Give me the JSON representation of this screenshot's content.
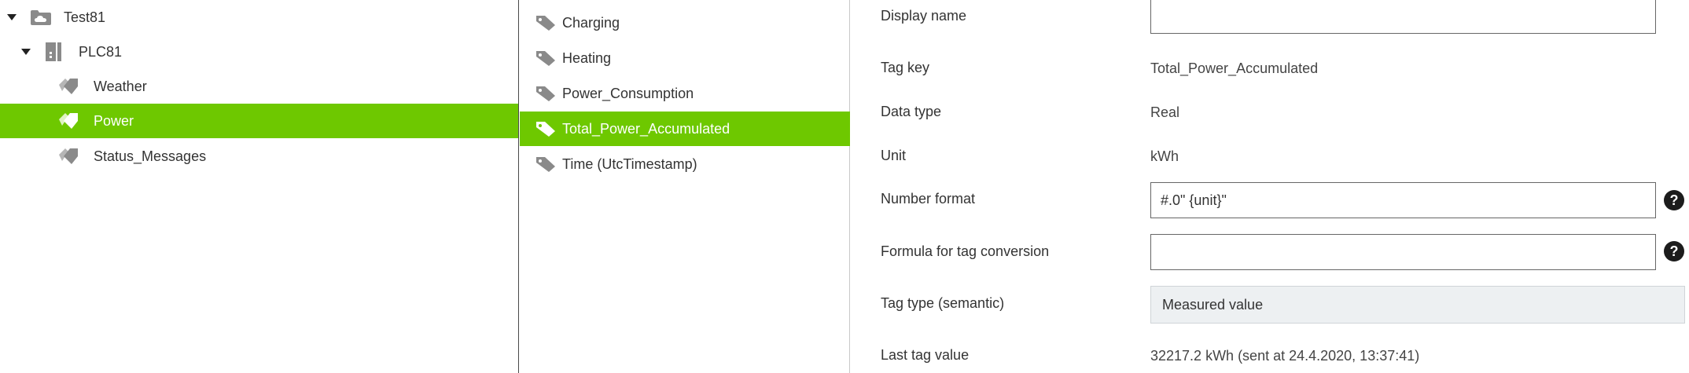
{
  "tree": {
    "items": [
      {
        "label": "Test81",
        "icon": "cloud-folder-icon",
        "level": 0,
        "expanded": true,
        "selected": false
      },
      {
        "label": "PLC81",
        "icon": "plc-device-icon",
        "level": 1,
        "expanded": true,
        "selected": false
      },
      {
        "label": "Weather",
        "icon": "tag-group-icon",
        "level": 2,
        "selected": false
      },
      {
        "label": "Power",
        "icon": "tag-group-icon",
        "level": 2,
        "selected": true
      },
      {
        "label": "Status_Messages",
        "icon": "tag-group-icon",
        "level": 2,
        "selected": false
      }
    ]
  },
  "tags": {
    "items": [
      {
        "label": "Charging",
        "selected": false
      },
      {
        "label": "Heating",
        "selected": false
      },
      {
        "label": "Power_Consumption",
        "selected": false
      },
      {
        "label": "Total_Power_Accumulated",
        "selected": true
      },
      {
        "label": "Time (UtcTimestamp)",
        "selected": false
      }
    ]
  },
  "properties": {
    "display_name": {
      "label": "Display name",
      "value": ""
    },
    "tag_key": {
      "label": "Tag key",
      "value": "Total_Power_Accumulated"
    },
    "data_type": {
      "label": "Data type",
      "value": "Real"
    },
    "unit": {
      "label": "Unit",
      "value": "kWh"
    },
    "number_format": {
      "label": "Number format",
      "value": "#.0\" {unit}\""
    },
    "formula": {
      "label": "Formula for tag conversion",
      "value": ""
    },
    "tag_type": {
      "label": "Tag type (semantic)",
      "value": "Measured value"
    },
    "last_value": {
      "label": "Last tag value",
      "value": "32217.2 kWh (sent at 24.4.2020, 13:37:41)"
    }
  },
  "help_glyph": "?",
  "colors": {
    "selection": "#6ec800",
    "icon_gray": "#8a8a8a",
    "readonly_bg": "#edf0f2"
  }
}
